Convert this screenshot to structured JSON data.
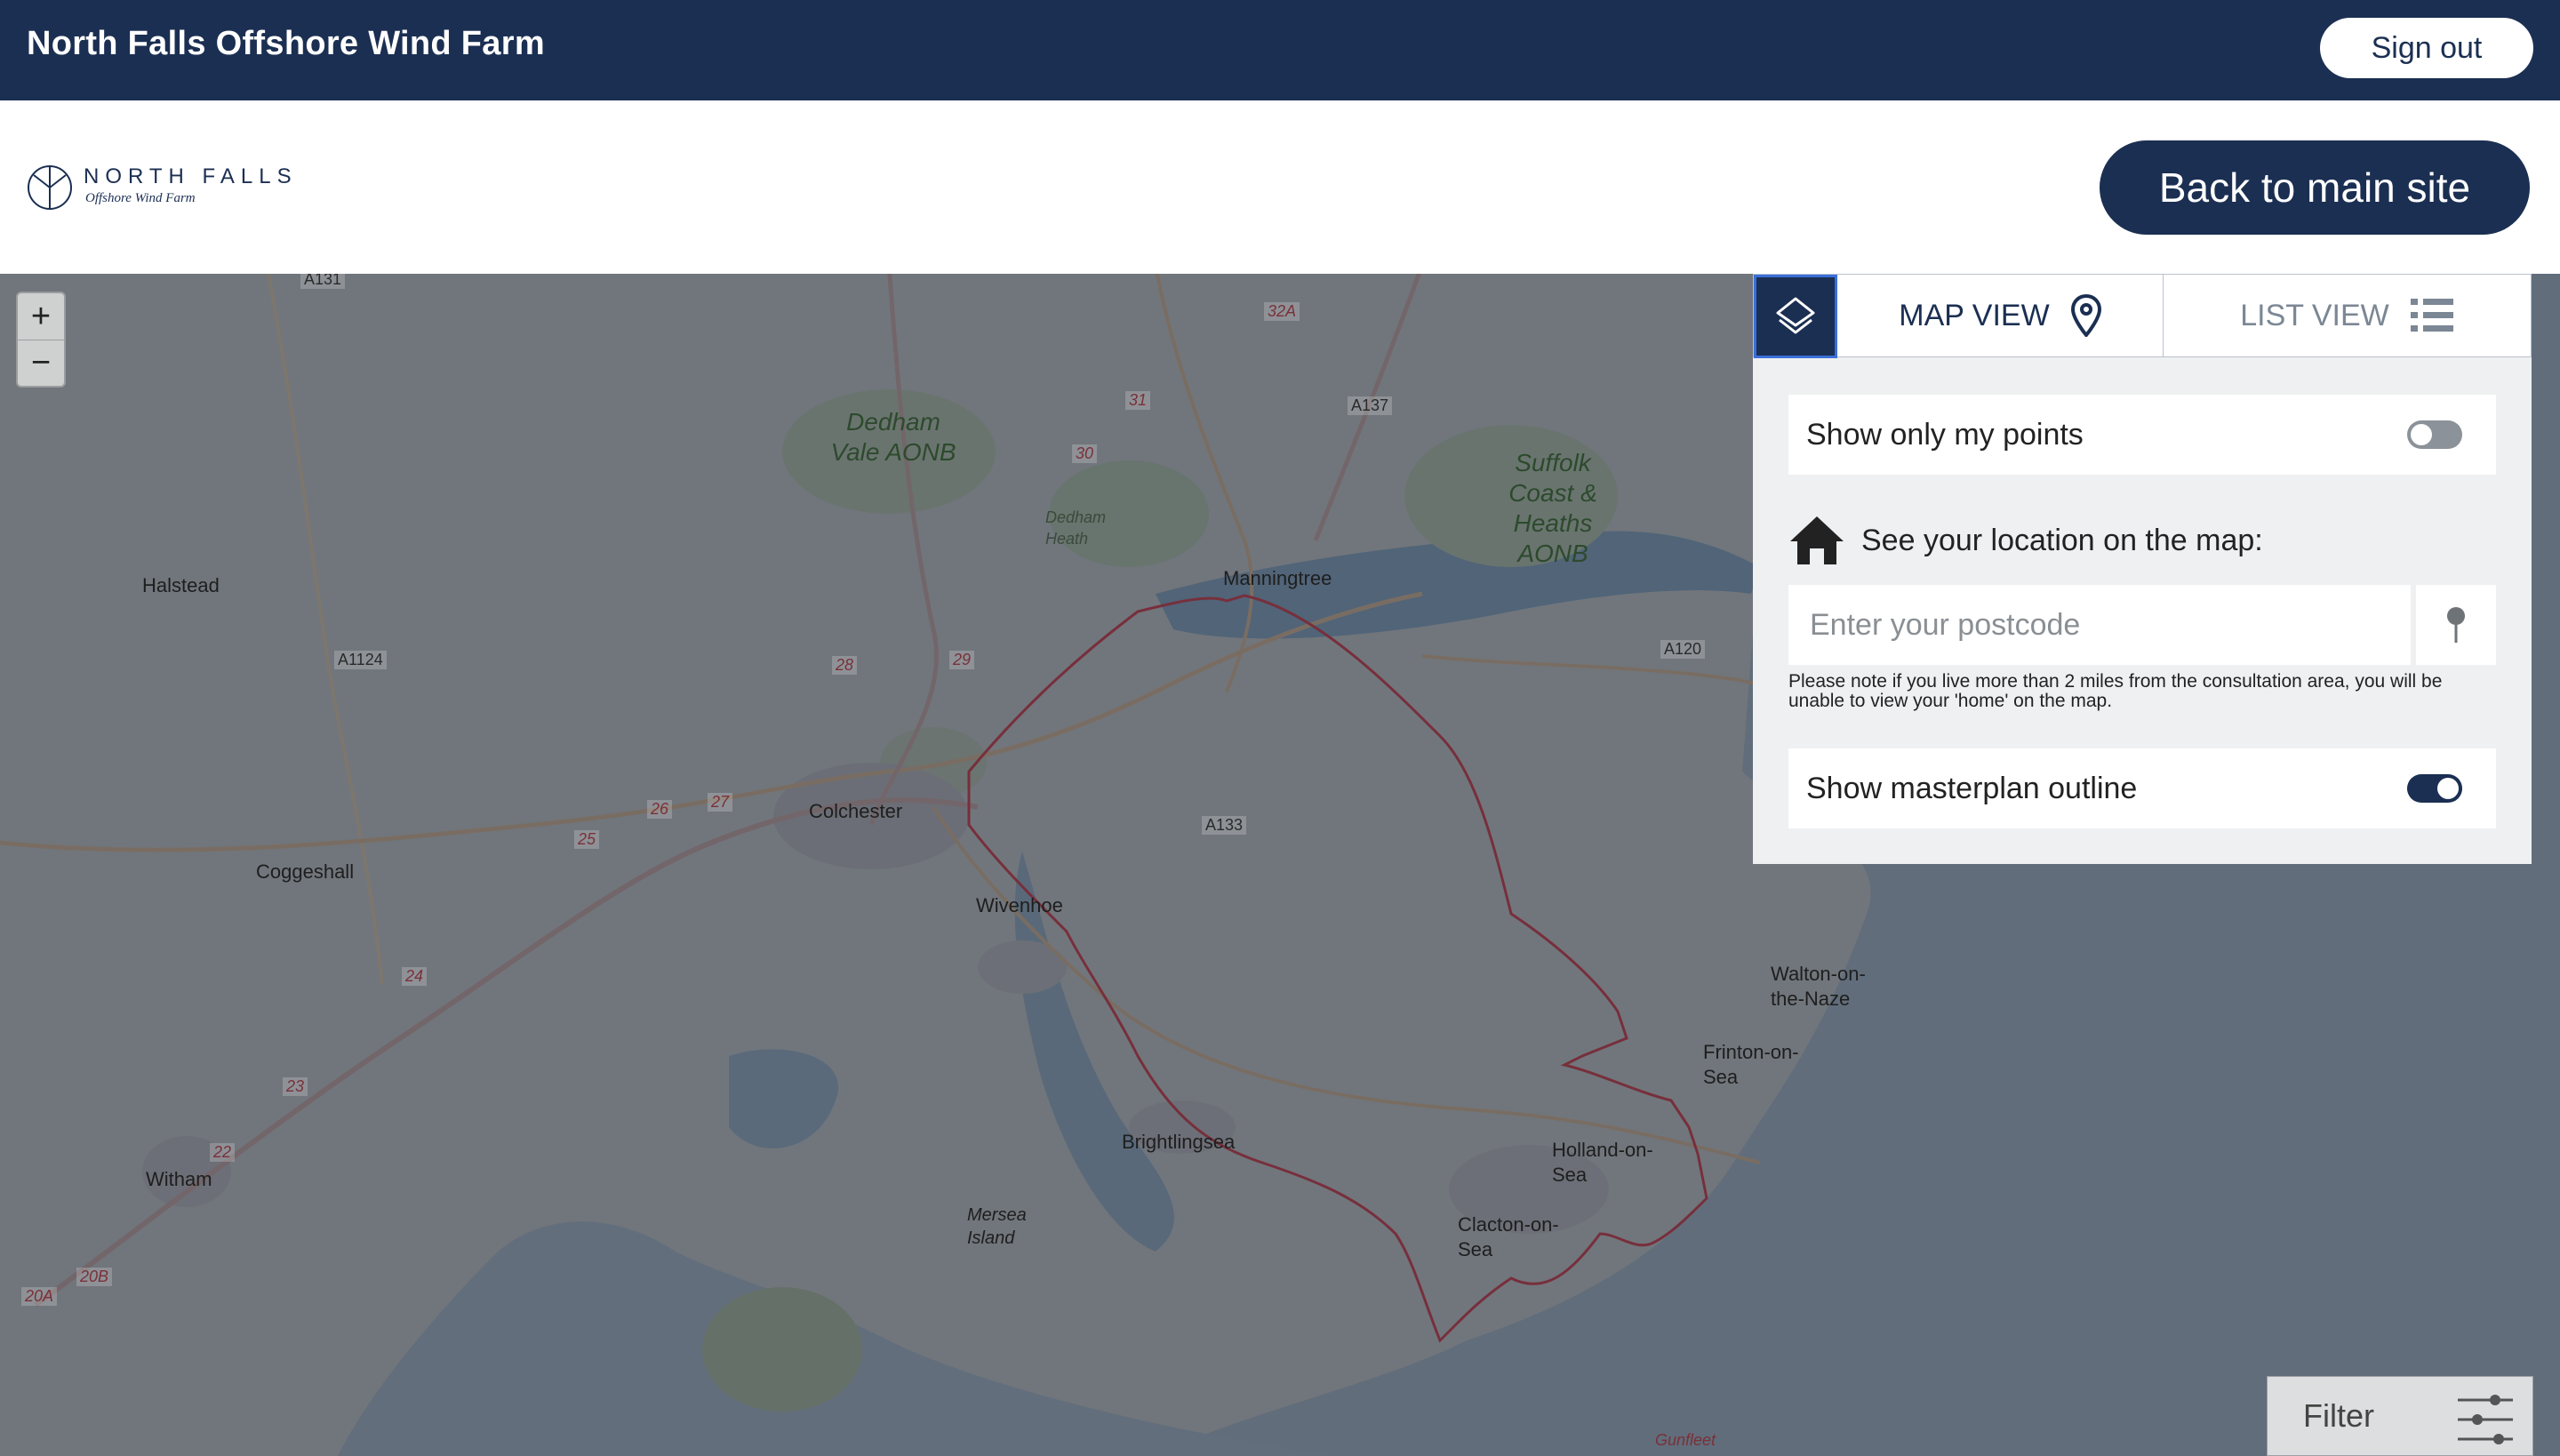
{
  "topbar": {
    "title": "North Falls Offshore Wind Farm",
    "sign_out_label": "Sign out"
  },
  "header": {
    "logo_name": "NORTH FALLS",
    "logo_subtitle": "Offshore Wind Farm",
    "back_label": "Back to main site"
  },
  "map": {
    "zoom_in": "+",
    "zoom_out": "−",
    "places": {
      "halstead": "Halstead",
      "coggeshall": "Coggeshall",
      "colchester": "Colchester",
      "wivenhoe": "Wivenhoe",
      "manningtree": "Manningtree",
      "witham": "Witham",
      "brightlingsea": "Brightlingsea",
      "walton": "Walton-on-the-Naze",
      "frinton": "Frinton-on-Sea",
      "holland": "Holland-on-Sea",
      "clacton": "Clacton-on-Sea",
      "mersea": "Mersea Island",
      "dedham_heath": "Dedham Heath",
      "gunfleet": "Gunfleet"
    },
    "aonb": {
      "dedham": "Dedham Vale AONB",
      "suffolk": "Suffolk Coast & Heaths AONB"
    },
    "roads": {
      "a131": "A131",
      "a1124": "A1124",
      "a137": "A137",
      "a120": "A120",
      "a133": "A133",
      "r32a": "32A",
      "r31": "31",
      "r30": "30",
      "r28": "28",
      "r29": "29",
      "r26": "26",
      "r27": "27",
      "r25": "25",
      "r24": "24",
      "r23": "23",
      "r22": "22",
      "r20a": "20A",
      "r20b": "20B"
    }
  },
  "panel": {
    "tabs": {
      "map_view": "MAP VIEW",
      "list_view": "LIST VIEW"
    },
    "show_my_points_label": "Show only my points",
    "show_my_points_on": false,
    "location_label": "See your location on the map:",
    "postcode_placeholder": "Enter your postcode",
    "note": "Please note if you live more than 2 miles from the consultation area, you will be unable to view your 'home' on the map.",
    "masterplan_label": "Show masterplan outline",
    "masterplan_on": true
  },
  "filter": {
    "label": "Filter"
  },
  "colors": {
    "navy": "#1b2f52",
    "masterplan_outline": "#b0303a"
  }
}
